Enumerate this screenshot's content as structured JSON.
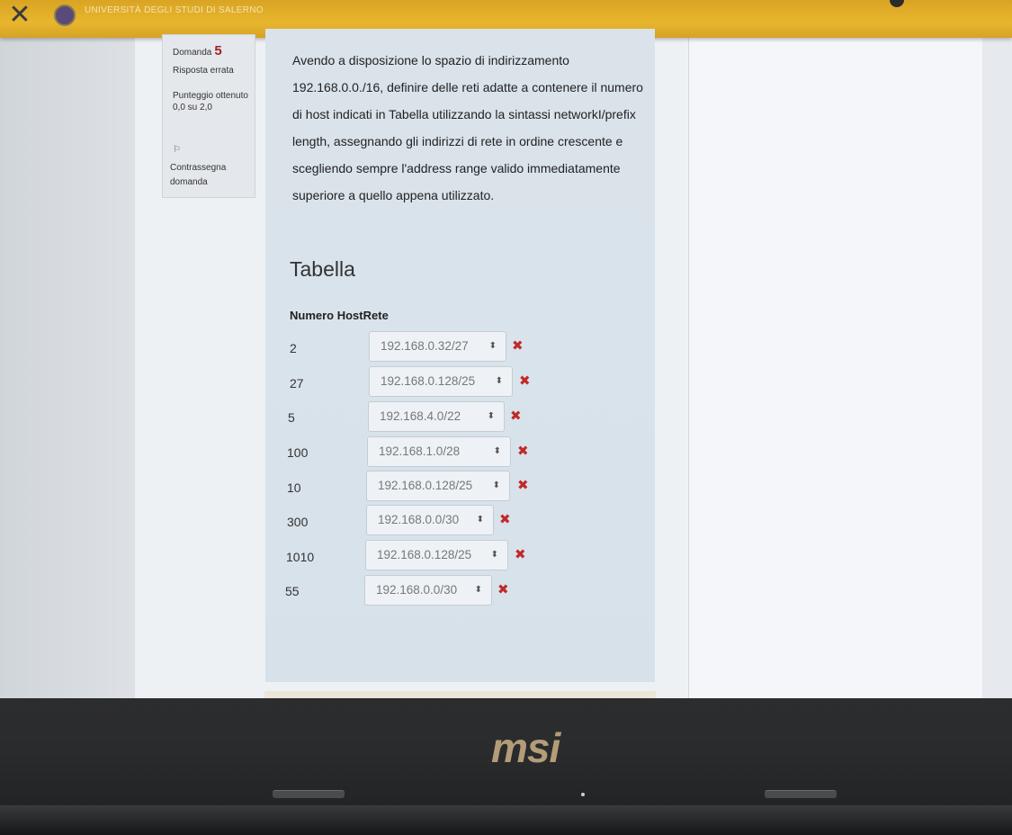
{
  "header": {
    "close_symbol": "✕",
    "university": "UNIVERSITÀ DEGLI STUDI DI SALERNO"
  },
  "question_info": {
    "label": "Domanda",
    "number": "5",
    "state": "Risposta errata",
    "grade": "Punteggio ottenuto 0,0 su 2,0",
    "flag_label": "Contrassegna domanda"
  },
  "question": {
    "text": "Avendo a disposizione lo spazio di indirizzamento 192.168.0.0./16, definire delle reti adatte a contenere il numero di host indicati in Tabella utilizzando la sintassi networkI/prefix length, assegnando gli indirizzi di rete in ordine crescente e scegliendo sempre l'address range valido immediatamente superiore a quello appena utilizzato.",
    "table_heading": "Tabella",
    "col_hosts": "Numero Host",
    "col_network": "Rete",
    "rows": [
      {
        "hosts": "2",
        "network": "192.168.0.32/27",
        "mark": "✖"
      },
      {
        "hosts": "27",
        "network": "192.168.0.128/25",
        "mark": "✖"
      },
      {
        "hosts": "5",
        "network": "192.168.4.0/22",
        "mark": "✖"
      },
      {
        "hosts": "100",
        "network": "192.168.1.0/28",
        "mark": "✖"
      },
      {
        "hosts": "10",
        "network": "192.168.0.128/25",
        "mark": "✖"
      },
      {
        "hosts": "300",
        "network": "192.168.0.0/30",
        "mark": "✖"
      },
      {
        "hosts": "1010",
        "network": "192.168.0.128/25",
        "mark": "✖"
      },
      {
        "hosts": "55",
        "network": "192.168.0.0/30",
        "mark": "✖"
      }
    ]
  },
  "laptop": {
    "brand": "msi"
  },
  "colors": {
    "topbar": "#e2b02b",
    "wrong_mark": "#c02a2a",
    "question_number": "#a12424"
  }
}
